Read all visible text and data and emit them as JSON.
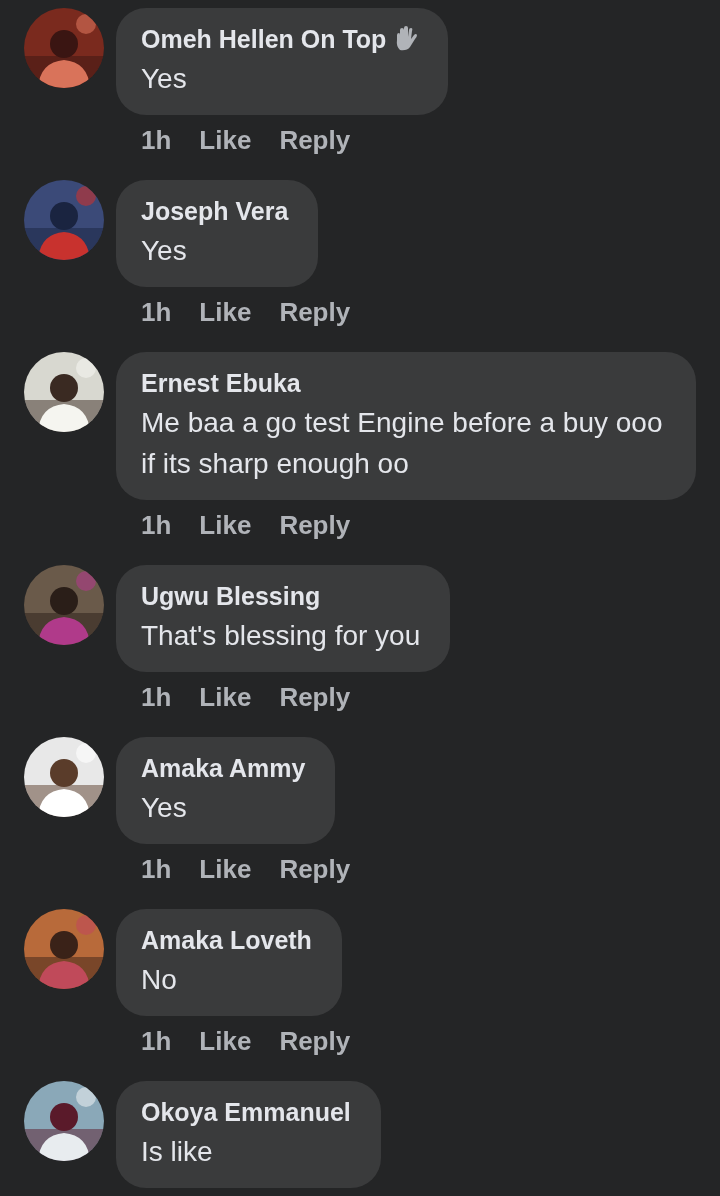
{
  "comments": [
    {
      "author": "Omeh Hellen On Top",
      "top_fan": true,
      "text": "Yes",
      "time": "1h",
      "like": "Like",
      "reply": "Reply"
    },
    {
      "author": "Joseph Vera",
      "top_fan": false,
      "text": "Yes",
      "time": "1h",
      "like": "Like",
      "reply": "Reply"
    },
    {
      "author": "Ernest Ebuka",
      "top_fan": false,
      "text": "Me baa a go test Engine before a buy ooo if its sharp enough oo",
      "time": "1h",
      "like": "Like",
      "reply": "Reply"
    },
    {
      "author": "Ugwu Blessing",
      "top_fan": false,
      "text": "That's blessing for you",
      "time": "1h",
      "like": "Like",
      "reply": "Reply"
    },
    {
      "author": "Amaka Ammy",
      "top_fan": false,
      "text": "Yes",
      "time": "1h",
      "like": "Like",
      "reply": "Reply"
    },
    {
      "author": "Amaka Loveth",
      "top_fan": false,
      "text": "No",
      "time": "1h",
      "like": "Like",
      "reply": "Reply"
    },
    {
      "author": "Okoya Emmanuel",
      "top_fan": false,
      "text": "Is like"
    }
  ]
}
